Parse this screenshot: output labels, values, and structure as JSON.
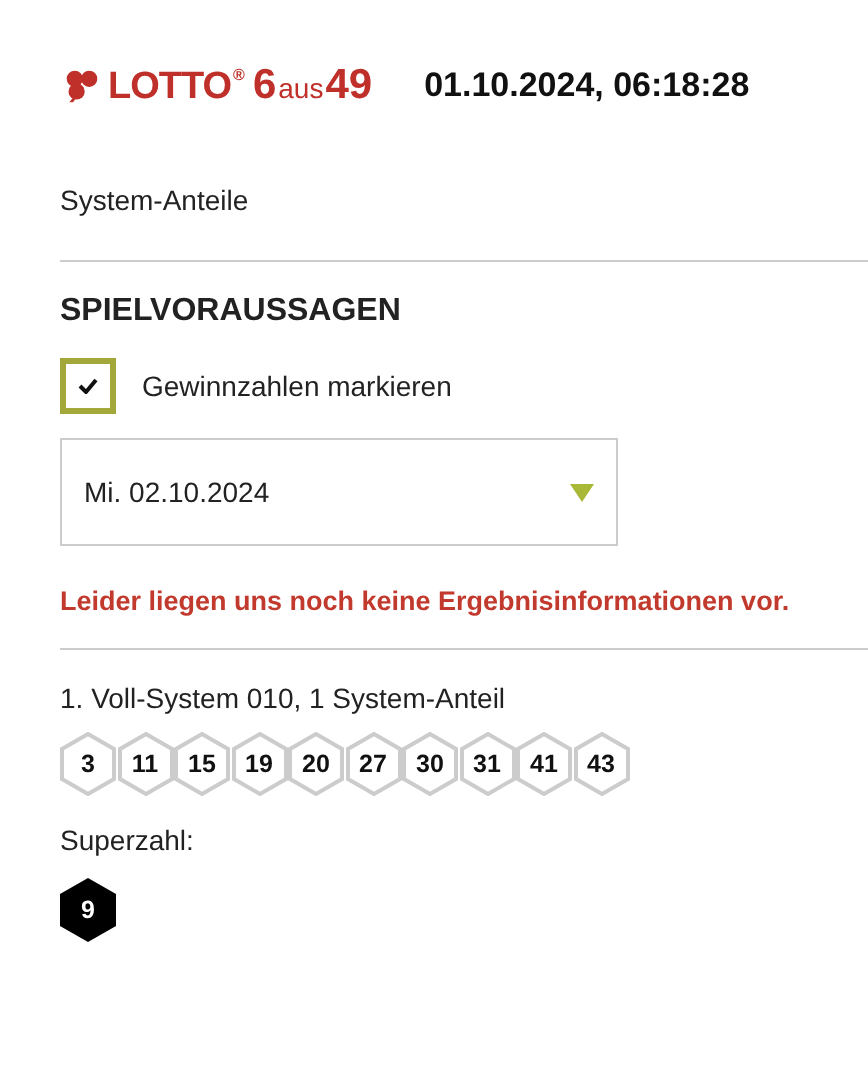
{
  "header": {
    "logo": {
      "word": "LOTTO",
      "mark": "®",
      "six": "6",
      "aus": "aus",
      "fortynine": "49"
    },
    "datetime": "01.10.2024, 06:18:28"
  },
  "section_title": "System-Anteile",
  "predictions": {
    "title": "SPIELVORAUSSAGEN",
    "checkbox": {
      "label": "Gewinnzahlen markieren",
      "checked": true
    },
    "date_select": {
      "value": "Mi. 02.10.2024"
    },
    "message": "Leider liegen uns noch keine Ergebnisinformationen vor."
  },
  "system": {
    "title": "1. Voll-System 010, 1 System-Anteil",
    "numbers": [
      "3",
      "11",
      "15",
      "19",
      "20",
      "27",
      "30",
      "31",
      "41",
      "43"
    ],
    "superzahl_label": "Superzahl:",
    "superzahl": "9"
  }
}
